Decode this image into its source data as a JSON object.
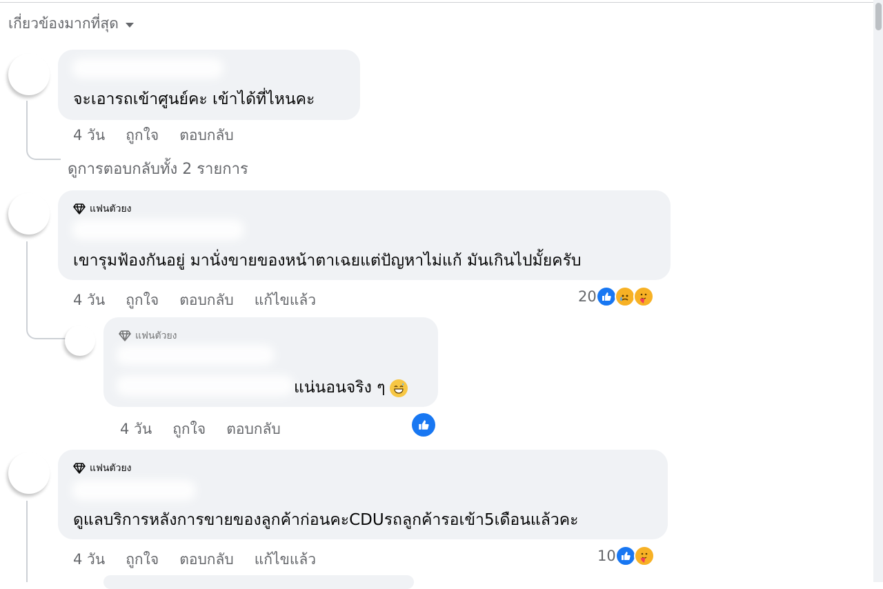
{
  "sort_label": "เกี่ยวข้องมากที่สุด",
  "view_replies": "ดูการตอบกลับทั้ง 2 รายการ",
  "comments": [
    {
      "text": "จะเอารถเข้าศูนย์คะ เข้าได้ที่ไหนคะ",
      "time": "4 วัน",
      "like": "ถูกใจ",
      "reply": "ตอบกลับ"
    },
    {
      "badge": "แฟนตัวยง",
      "text": "เขารุมฟ้องกันอยู่ มานั่งขายของหน้าตาเฉยแต่ปัญหาไม่แก้ มันเกินไปมั้ยครับ",
      "time": "4 วัน",
      "like": "ถูกใจ",
      "reply": "ตอบกลับ",
      "edited": "แก้ไขแล้ว",
      "reaction_count": "20",
      "reactions": [
        "like-icon",
        "sad-icon",
        "care-icon"
      ]
    },
    {
      "badge": "แฟนตัวยง",
      "text": "แน่นอนจริง ๆ",
      "emoji": "grinning-sweat-emoji",
      "time": "4 วัน",
      "like": "ถูกใจ",
      "reply": "ตอบกลับ",
      "reactions": [
        "like-icon"
      ]
    },
    {
      "badge": "แฟนตัวยง",
      "text": "ดูแลบริการหลังการขายของลูกค้าก่อนคะCDUรถลูกค้ารอเข้า5เดือนแล้วคะ",
      "time": "4 วัน",
      "like": "ถูกใจ",
      "reply": "ตอบกลับ",
      "edited": "แก้ไขแล้ว",
      "reaction_count": "10",
      "reactions": [
        "like-icon",
        "care-icon"
      ]
    }
  ],
  "colors": {
    "bubble": "#f0f2f5",
    "meta_text": "#65676b",
    "like_blue": "#1877f2",
    "emoji_yellow": "#f7b125"
  }
}
